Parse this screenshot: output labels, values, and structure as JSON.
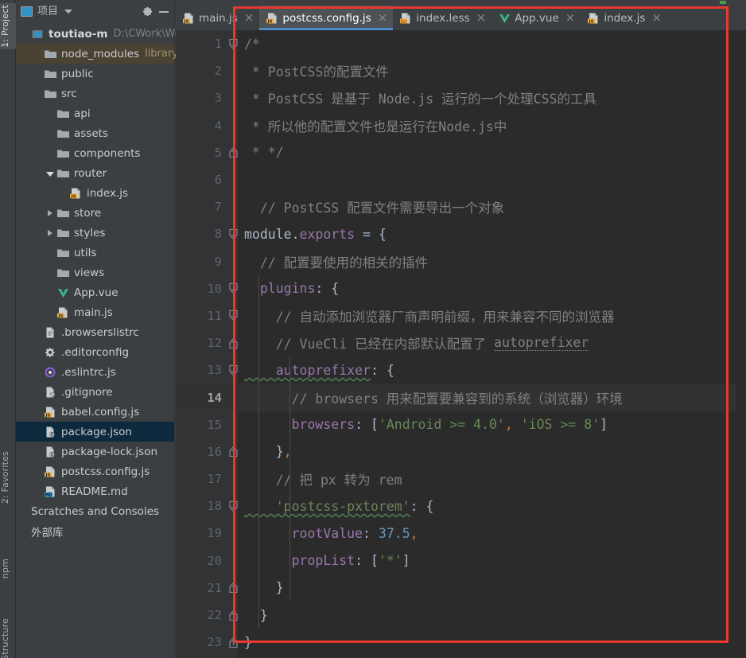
{
  "toolstrip": {
    "tabs": [
      {
        "label": "1: Project",
        "active": true
      },
      {
        "label": "2: Favorites",
        "active": false
      },
      {
        "label": "npm",
        "active": false
      },
      {
        "label": "Structure",
        "active": false
      }
    ]
  },
  "project_panel": {
    "title": "项目",
    "icons": {
      "project": "project-icon",
      "dropdown": "chevron-down-icon",
      "settings": "gear-icon",
      "collapse": "minimize-icon"
    },
    "tree": [
      {
        "label": "toutiao-m",
        "sub": "D:\\CWork\\Web",
        "indent": 0,
        "icon": "project-root-icon",
        "twisty": "none",
        "bold": true,
        "selected": false,
        "highlight": "none"
      },
      {
        "label": "node_modules",
        "sub": "library r",
        "indent": 1,
        "icon": "folder-icon",
        "twisty": "none",
        "bold": false,
        "selected": false,
        "highlight": "library"
      },
      {
        "label": "public",
        "sub": "",
        "indent": 1,
        "icon": "folder-icon",
        "twisty": "none",
        "bold": false,
        "selected": false,
        "highlight": "none"
      },
      {
        "label": "src",
        "sub": "",
        "indent": 1,
        "icon": "folder-icon",
        "twisty": "none",
        "bold": false,
        "selected": false,
        "highlight": "none"
      },
      {
        "label": "api",
        "sub": "",
        "indent": 2,
        "icon": "folder-icon",
        "twisty": "none",
        "bold": false,
        "selected": false,
        "highlight": "none"
      },
      {
        "label": "assets",
        "sub": "",
        "indent": 2,
        "icon": "folder-icon",
        "twisty": "none",
        "bold": false,
        "selected": false,
        "highlight": "none"
      },
      {
        "label": "components",
        "sub": "",
        "indent": 2,
        "icon": "folder-icon",
        "twisty": "none",
        "bold": false,
        "selected": false,
        "highlight": "none"
      },
      {
        "label": "router",
        "sub": "",
        "indent": 2,
        "icon": "folder-icon",
        "twisty": "open",
        "bold": false,
        "selected": false,
        "highlight": "none"
      },
      {
        "label": "index.js",
        "sub": "",
        "indent": 3,
        "icon": "js-file-icon",
        "twisty": "none",
        "bold": false,
        "selected": false,
        "highlight": "none"
      },
      {
        "label": "store",
        "sub": "",
        "indent": 2,
        "icon": "folder-icon",
        "twisty": "closed",
        "bold": false,
        "selected": false,
        "highlight": "none"
      },
      {
        "label": "styles",
        "sub": "",
        "indent": 2,
        "icon": "folder-icon",
        "twisty": "closed",
        "bold": false,
        "selected": false,
        "highlight": "none"
      },
      {
        "label": "utils",
        "sub": "",
        "indent": 2,
        "icon": "folder-icon",
        "twisty": "none",
        "bold": false,
        "selected": false,
        "highlight": "none"
      },
      {
        "label": "views",
        "sub": "",
        "indent": 2,
        "icon": "folder-icon",
        "twisty": "none",
        "bold": false,
        "selected": false,
        "highlight": "none"
      },
      {
        "label": "App.vue",
        "sub": "",
        "indent": 2,
        "icon": "vue-file-icon",
        "twisty": "none",
        "bold": false,
        "selected": false,
        "highlight": "none"
      },
      {
        "label": "main.js",
        "sub": "",
        "indent": 2,
        "icon": "js-file-icon",
        "twisty": "none",
        "bold": false,
        "selected": false,
        "highlight": "none"
      },
      {
        "label": ".browserslistrc",
        "sub": "",
        "indent": 1,
        "icon": "text-file-icon",
        "twisty": "none",
        "bold": false,
        "selected": false,
        "highlight": "none"
      },
      {
        "label": ".editorconfig",
        "sub": "",
        "indent": 1,
        "icon": "gear-file-icon",
        "twisty": "none",
        "bold": false,
        "selected": false,
        "highlight": "none"
      },
      {
        "label": ".eslintrc.js",
        "sub": "",
        "indent": 1,
        "icon": "eslint-file-icon",
        "twisty": "none",
        "bold": false,
        "selected": false,
        "highlight": "none"
      },
      {
        "label": ".gitignore",
        "sub": "",
        "indent": 1,
        "icon": "ignored-file-icon",
        "twisty": "none",
        "bold": false,
        "selected": false,
        "highlight": "none"
      },
      {
        "label": "babel.config.js",
        "sub": "",
        "indent": 1,
        "icon": "js-file-icon",
        "twisty": "none",
        "bold": false,
        "selected": false,
        "highlight": "none"
      },
      {
        "label": "package.json",
        "sub": "",
        "indent": 1,
        "icon": "json-file-icon",
        "twisty": "none",
        "bold": false,
        "selected": true,
        "highlight": "none"
      },
      {
        "label": "package-lock.json",
        "sub": "",
        "indent": 1,
        "icon": "json-file-icon",
        "twisty": "none",
        "bold": false,
        "selected": false,
        "highlight": "none"
      },
      {
        "label": "postcss.config.js",
        "sub": "",
        "indent": 1,
        "icon": "js-file-icon",
        "twisty": "none",
        "bold": false,
        "selected": false,
        "highlight": "none"
      },
      {
        "label": "README.md",
        "sub": "",
        "indent": 1,
        "icon": "md-file-icon",
        "twisty": "none",
        "bold": false,
        "selected": false,
        "highlight": "none"
      },
      {
        "label": "Scratches and Consoles",
        "sub": "",
        "indent": 0,
        "icon": "none",
        "twisty": "none",
        "bold": false,
        "selected": false,
        "highlight": "none"
      },
      {
        "label": "外部库",
        "sub": "",
        "indent": 0,
        "icon": "none",
        "twisty": "none",
        "bold": false,
        "selected": false,
        "highlight": "none"
      }
    ]
  },
  "editor": {
    "tabs": [
      {
        "label": "main.js",
        "icon": "js-file-icon",
        "active": false,
        "close": "×"
      },
      {
        "label": "postcss.config.js",
        "icon": "js-file-icon",
        "active": true,
        "close": "×"
      },
      {
        "label": "index.less",
        "icon": "less-file-icon",
        "active": false,
        "close": "×"
      },
      {
        "label": "App.vue",
        "icon": "vue-file-icon",
        "active": false,
        "close": "×"
      },
      {
        "label": "index.js",
        "icon": "js-file-icon",
        "active": false,
        "close": "×"
      }
    ],
    "current_line": 14,
    "lines": [
      {
        "n": 1,
        "fold": "down",
        "indent": 0,
        "tokens": [
          {
            "t": "/*",
            "c": "cm"
          }
        ]
      },
      {
        "n": 2,
        "fold": "",
        "indent": 0,
        "tokens": [
          {
            "t": " * PostCSS的配置文件",
            "c": "cm"
          }
        ]
      },
      {
        "n": 3,
        "fold": "",
        "indent": 0,
        "tokens": [
          {
            "t": " * PostCSS 是基于 Node.js 运行的一个处理CSS的工具",
            "c": "cm"
          }
        ]
      },
      {
        "n": 4,
        "fold": "",
        "indent": 0,
        "tokens": [
          {
            "t": " * 所以他的配置文件也是运行在Node.js中",
            "c": "cm"
          }
        ]
      },
      {
        "n": 5,
        "fold": "up",
        "indent": 0,
        "tokens": [
          {
            "t": " * */",
            "c": "cm"
          }
        ]
      },
      {
        "n": 6,
        "fold": "",
        "indent": 0,
        "tokens": []
      },
      {
        "n": 7,
        "fold": "",
        "indent": 0,
        "tokens": [
          {
            "t": "  // PostCSS 配置文件需要导出一个对象",
            "c": "cm"
          }
        ]
      },
      {
        "n": 8,
        "fold": "down",
        "indent": 0,
        "tokens": [
          {
            "t": "module",
            "c": "pn"
          },
          {
            "t": ".",
            "c": "pn"
          },
          {
            "t": "exports",
            "c": "pl"
          },
          {
            "t": " = {",
            "c": "pn"
          }
        ]
      },
      {
        "n": 9,
        "fold": "",
        "indent": 1,
        "tokens": [
          {
            "t": "  // 配置要使用的相关的插件",
            "c": "cm"
          }
        ]
      },
      {
        "n": 10,
        "fold": "down",
        "indent": 1,
        "tokens": [
          {
            "t": "  plugins",
            "c": "pl"
          },
          {
            "t": ": {",
            "c": "pn"
          }
        ]
      },
      {
        "n": 11,
        "fold": "down",
        "indent": 2,
        "tokens": [
          {
            "t": "    // 自动添加浏览器厂商声明前缀，用来兼容不同的浏览器",
            "c": "cm"
          }
        ]
      },
      {
        "n": 12,
        "fold": "up",
        "indent": 2,
        "tokens": [
          {
            "t": "    // VueCli 已经在内部默认配置了 ",
            "c": "cm"
          },
          {
            "t": "autoprefixer",
            "c": "cm typo"
          }
        ]
      },
      {
        "n": 13,
        "fold": "down",
        "indent": 2,
        "tokens": [
          {
            "t": "    autoprefixer",
            "c": "pl wav"
          },
          {
            "t": ": {",
            "c": "pn"
          }
        ]
      },
      {
        "n": 14,
        "fold": "",
        "indent": 3,
        "tokens": [
          {
            "t": "      // browsers 用来配置要兼容到的系统（浏览器）环境",
            "c": "cm"
          }
        ]
      },
      {
        "n": 15,
        "fold": "",
        "indent": 3,
        "tokens": [
          {
            "t": "      browsers",
            "c": "pl"
          },
          {
            "t": ": [",
            "c": "pn"
          },
          {
            "t": "'Android >= 4.0'",
            "c": "str"
          },
          {
            "t": ",",
            "c": "cma"
          },
          {
            "t": " ",
            "c": "pn"
          },
          {
            "t": "'iOS >= 8'",
            "c": "str"
          },
          {
            "t": "]",
            "c": "pn"
          }
        ]
      },
      {
        "n": 16,
        "fold": "up",
        "indent": 2,
        "tokens": [
          {
            "t": "    }",
            "c": "pn"
          },
          {
            "t": ",",
            "c": "cma"
          }
        ]
      },
      {
        "n": 17,
        "fold": "",
        "indent": 2,
        "tokens": [
          {
            "t": "    // 把 px 转为 rem",
            "c": "cm"
          }
        ]
      },
      {
        "n": 18,
        "fold": "down",
        "indent": 2,
        "tokens": [
          {
            "t": "    'postcss-pxtorem'",
            "c": "str wav"
          },
          {
            "t": ": {",
            "c": "pn"
          }
        ]
      },
      {
        "n": 19,
        "fold": "",
        "indent": 3,
        "tokens": [
          {
            "t": "      rootValue",
            "c": "pl"
          },
          {
            "t": ": ",
            "c": "pn"
          },
          {
            "t": "37.5",
            "c": "num"
          },
          {
            "t": ",",
            "c": "cma"
          }
        ]
      },
      {
        "n": 20,
        "fold": "",
        "indent": 3,
        "tokens": [
          {
            "t": "      propList",
            "c": "pl"
          },
          {
            "t": ": [",
            "c": "pn"
          },
          {
            "t": "'*'",
            "c": "str"
          },
          {
            "t": "]",
            "c": "pn"
          }
        ]
      },
      {
        "n": 21,
        "fold": "up",
        "indent": 2,
        "tokens": [
          {
            "t": "    }",
            "c": "pn"
          }
        ]
      },
      {
        "n": 22,
        "fold": "up",
        "indent": 1,
        "tokens": [
          {
            "t": "  }",
            "c": "pn"
          }
        ]
      },
      {
        "n": 23,
        "fold": "up",
        "indent": 0,
        "tokens": [
          {
            "t": "}",
            "c": "pn"
          }
        ]
      }
    ]
  },
  "annotation": {
    "shape": "rectangle",
    "color": "#e8382f"
  },
  "colors": {
    "editor_bg": "#2b2b2b",
    "gutter_bg": "#313335",
    "panel_bg": "#3c3f41",
    "tab_active_bg": "#4e5254",
    "tab_active_underline": "#4a88c7",
    "selection_bg": "#0d293e",
    "library_row_bg": "#4a4334",
    "comment": "#808080",
    "string": "#6a8759",
    "number": "#6897bb",
    "property": "#9876aa",
    "punctuation": "#a9b7c6",
    "keyword": "#cc7832"
  }
}
